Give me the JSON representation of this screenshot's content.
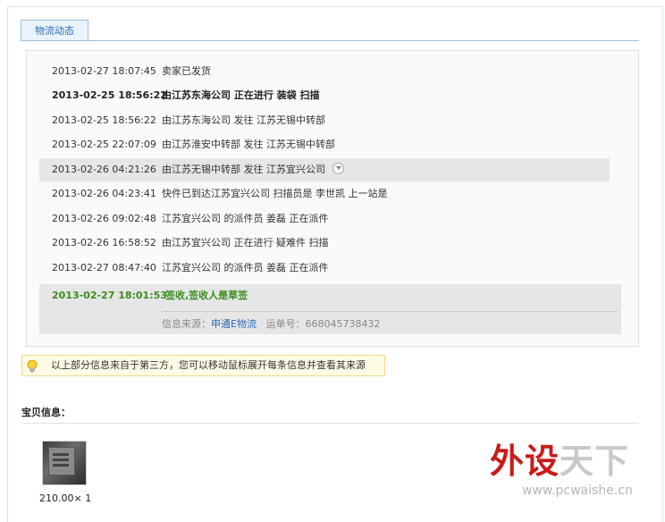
{
  "tab": {
    "label": "物流动态"
  },
  "events": [
    {
      "time": "2013-02-27 18:07:45",
      "message": "卖家已发货"
    },
    {
      "time": "2013-02-25 18:56:22",
      "message": "由江苏东海公司 正在进行 装袋 扫描"
    },
    {
      "time": "2013-02-25 18:56:22",
      "message": "由江苏东海公司 发往 江苏无锡中转部"
    },
    {
      "time": "2013-02-25 22:07:09",
      "message": "由江苏淮安中转部 发往 江苏无锡中转部"
    },
    {
      "time": "2013-02-26 04:21:26",
      "message": "由江苏无锡中转部 发往 江苏宜兴公司"
    },
    {
      "time": "2013-02-26 04:23:41",
      "message": "快件已到达江苏宜兴公司 扫描员是 李世凯 上一站是"
    },
    {
      "time": "2013-02-26 09:02:48",
      "message": "江苏宜兴公司 的派件员 姜磊 正在派件"
    },
    {
      "time": "2013-02-26 16:58:52",
      "message": "由江苏宜兴公司 正在进行 疑难件 扫描"
    },
    {
      "time": "2013-02-27 08:47:40",
      "message": "江苏宜兴公司 的派件员 姜磊 正在派件"
    }
  ],
  "final": {
    "time": "2013-02-27 18:01:53",
    "message": "签收,签收人是草签",
    "source_label": "信息来源：",
    "source_link": "申通E物流",
    "tracking_label": "运单号：",
    "tracking_number": "668045738432"
  },
  "notice": {
    "text": "以上部分信息来自于第三方，您可以移动鼠标展开每条信息并查看其来源",
    "icon": "lightbulb-icon"
  },
  "product": {
    "title": "宝贝信息：",
    "price": "210.00×",
    "quantity": "1"
  },
  "watermark": {
    "brand_red": "外设",
    "brand_gray": "天下",
    "url": "www.pcwaishe.cn"
  },
  "colors": {
    "link": "#2a6bb3",
    "signed": "#3c8c1e",
    "highlight_row": "#e6e6e6",
    "brand_red": "#c91b1b"
  }
}
